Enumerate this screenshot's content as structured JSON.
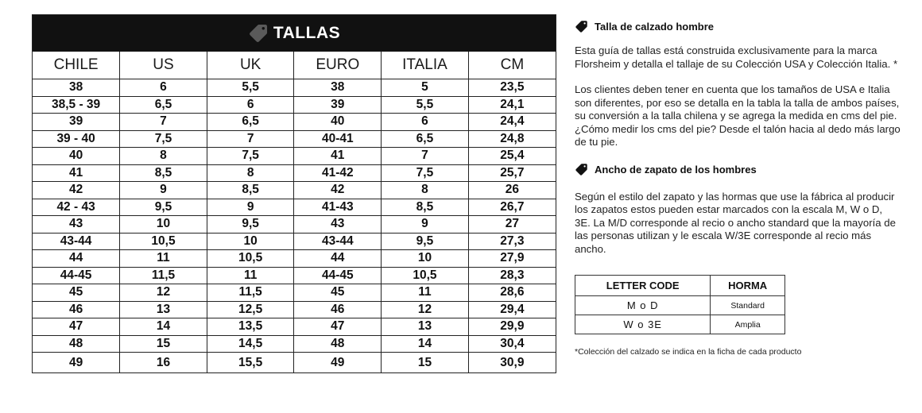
{
  "size_guide": {
    "title": "TALLAS",
    "title_icon": "tag-icon",
    "columns": [
      "CHILE",
      "US",
      "UK",
      "EURO",
      "ITALIA",
      "CM"
    ],
    "rows": [
      [
        "38",
        "6",
        "5,5",
        "38",
        "5",
        "23,5"
      ],
      [
        "38,5 - 39",
        "6,5",
        "6",
        "39",
        "5,5",
        "24,1"
      ],
      [
        "39",
        "7",
        "6,5",
        "40",
        "6",
        "24,4"
      ],
      [
        "39 - 40",
        "7,5",
        "7",
        "40-41",
        "6,5",
        "24,8"
      ],
      [
        "40",
        "8",
        "7,5",
        "41",
        "7",
        "25,4"
      ],
      [
        "41",
        "8,5",
        "8",
        "41-42",
        "7,5",
        "25,7"
      ],
      [
        "42",
        "9",
        "8,5",
        "42",
        "8",
        "26"
      ],
      [
        "42 - 43",
        "9,5",
        "9",
        "41-43",
        "8,5",
        "26,7"
      ],
      [
        "43",
        "10",
        "9,5",
        "43",
        "9",
        "27"
      ],
      [
        "43-44",
        "10,5",
        "10",
        "43-44",
        "9,5",
        "27,3"
      ],
      [
        "44",
        "11",
        "10,5",
        "44",
        "10",
        "27,9"
      ],
      [
        "44-45",
        "11,5",
        "11",
        "44-45",
        "10,5",
        "28,3"
      ],
      [
        "45",
        "12",
        "11,5",
        "45",
        "11",
        "28,6"
      ],
      [
        "46",
        "13",
        "12,5",
        "46",
        "12",
        "29,4"
      ],
      [
        "47",
        "14",
        "13,5",
        "47",
        "13",
        "29,9"
      ],
      [
        "48",
        "15",
        "14,5",
        "48",
        "14",
        "30,4"
      ],
      [
        "49",
        "16",
        "15,5",
        "49",
        "15",
        "30,9"
      ]
    ]
  },
  "info": {
    "section1": {
      "icon": "tag-icon",
      "heading": "Talla de calzado hombre",
      "p1": "Esta guía de tallas está construida exclusivamente para la marca Florsheim y detalla el tallaje de su Colección USA y Colección Italia. *",
      "p2": "Los clientes deben tener en cuenta que los tamaños de USA e Italia son diferentes, por eso se detalla en la tabla la talla de ambos países, su conversión a la talla chilena y se agrega la medida en cms del pie.",
      "p3": "¿Cómo medir los cms del pie? Desde el talón hacia al dedo más largo de tu pie."
    },
    "section2": {
      "icon": "tag-icon",
      "heading": "Ancho de zapato de los hombres",
      "p1": "Según el estilo del zapato y las hormas que use la fábrica al producir los zapatos estos pueden estar marcados con la escala M, W o D, 3E.  La M/D corresponde al recio o ancho standard que la mayoría de las personas utilizan y le escala W/3E corresponde al recio más ancho."
    },
    "width_table": {
      "headers": [
        "LETTER CODE",
        "HORMA"
      ],
      "rows": [
        [
          "M o D",
          "Standard"
        ],
        [
          "W o 3E",
          "Amplia"
        ]
      ]
    },
    "footnote": "*Colección del calzado se indica en la ficha de cada producto"
  }
}
